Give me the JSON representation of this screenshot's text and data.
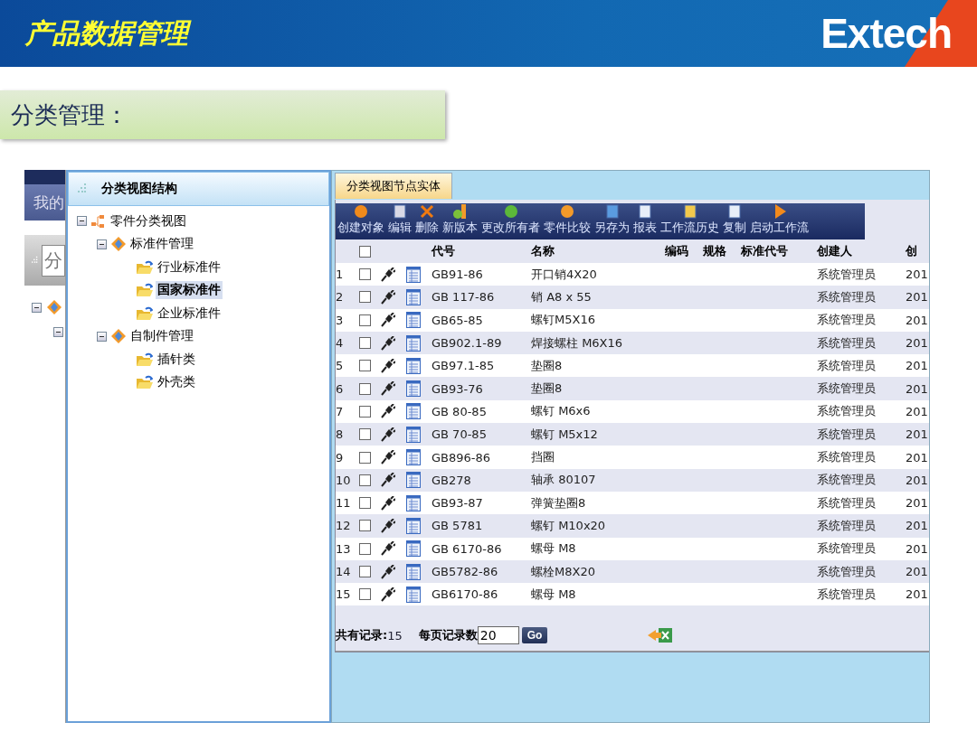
{
  "header": {
    "title": "产品数据管理",
    "logo": "Extech"
  },
  "section": {
    "label": "分类管理："
  },
  "back_window": {
    "tab": "我的",
    "field": "分"
  },
  "tree_panel": {
    "title": "分类视图结构",
    "nodes": [
      {
        "label": "零件分类视图",
        "kind": "root",
        "expanded": true,
        "selected": false,
        "children": [
          {
            "label": "标准件管理",
            "kind": "group",
            "expanded": true,
            "selected": false,
            "children": [
              {
                "label": "行业标准件",
                "kind": "folder",
                "selected": false
              },
              {
                "label": "国家标准件",
                "kind": "folder",
                "selected": true
              },
              {
                "label": "企业标准件",
                "kind": "folder",
                "selected": false
              }
            ]
          },
          {
            "label": "自制件管理",
            "kind": "group",
            "expanded": true,
            "selected": false,
            "children": [
              {
                "label": "插针类",
                "kind": "folder",
                "selected": false
              },
              {
                "label": "外壳类",
                "kind": "folder",
                "selected": false
              }
            ]
          }
        ]
      }
    ]
  },
  "tabs": [
    {
      "label": "分类视图节点实体",
      "selected": true
    }
  ],
  "toolbar": [
    {
      "label": "创建对象",
      "kind": "create"
    },
    {
      "label": "编辑",
      "kind": "edit"
    },
    {
      "label": "删除",
      "kind": "delete"
    },
    {
      "label": "新版本",
      "kind": "version"
    },
    {
      "label": "更改所有者",
      "kind": "owner"
    },
    {
      "label": "零件比较",
      "kind": "compare"
    },
    {
      "label": "另存为",
      "kind": "saveas"
    },
    {
      "label": "报表",
      "kind": "report"
    },
    {
      "label": "工作流历史",
      "kind": "history"
    },
    {
      "label": "复制",
      "kind": "copy"
    },
    {
      "label": "启动工作流",
      "kind": "start"
    }
  ],
  "table": {
    "select_all_checked": false,
    "columns": [
      "代号",
      "名称",
      "编码",
      "规格",
      "标准代号",
      "创建人",
      "创"
    ],
    "rows": [
      {
        "index": "1",
        "checked": false,
        "code": "GB91-86",
        "name": "开口销4X20",
        "creator": "系统管理员",
        "column_7": "201"
      },
      {
        "index": "2",
        "checked": false,
        "code": "GB 117-86",
        "name": "销  A8 x 55",
        "creator": "系统管理员",
        "column_7": "201"
      },
      {
        "index": "3",
        "checked": false,
        "code": "GB65-85",
        "name": "螺钉M5X16",
        "creator": "系统管理员",
        "column_7": "201"
      },
      {
        "index": "4",
        "checked": false,
        "code": "GB902.1-89",
        "name": "焊接螺柱  M6X16",
        "creator": "系统管理员",
        "column_7": "201"
      },
      {
        "index": "5",
        "checked": false,
        "code": "GB97.1-85",
        "name": "垫圈8",
        "creator": "系统管理员",
        "column_7": "201"
      },
      {
        "index": "6",
        "checked": false,
        "code": "GB93-76",
        "name": "垫圈8",
        "creator": "系统管理员",
        "column_7": "201"
      },
      {
        "index": "7",
        "checked": false,
        "code": "GB 80-85",
        "name": "螺钉  M6x6",
        "creator": "系统管理员",
        "column_7": "201"
      },
      {
        "index": "8",
        "checked": false,
        "code": "GB 70-85",
        "name": "螺钉  M5x12",
        "creator": "系统管理员",
        "column_7": "201"
      },
      {
        "index": "9",
        "checked": false,
        "code": "GB896-86",
        "name": "挡圈",
        "creator": "系统管理员",
        "column_7": "201"
      },
      {
        "index": "10",
        "checked": false,
        "code": "GB278",
        "name": "轴承  80107",
        "creator": "系统管理员",
        "column_7": "201"
      },
      {
        "index": "11",
        "checked": false,
        "code": "GB93-87",
        "name": "弹簧垫圈8",
        "creator": "系统管理员",
        "column_7": "201"
      },
      {
        "index": "12",
        "checked": false,
        "code": "GB 5781",
        "name": "螺钉  M10x20",
        "creator": "系统管理员",
        "column_7": "201"
      },
      {
        "index": "13",
        "checked": false,
        "code": "GB 6170-86",
        "name": "螺母  M8",
        "creator": "系统管理员",
        "column_7": "201"
      },
      {
        "index": "14",
        "checked": false,
        "code": "GB5782-86",
        "name": "螺栓M8X20",
        "creator": "系统管理员",
        "column_7": "201"
      },
      {
        "index": "15",
        "checked": false,
        "code": "GB6170-86",
        "name": "螺母  M8",
        "creator": "系统管理员",
        "column_7": "201"
      }
    ]
  },
  "footer": {
    "total_label": "共有记录:",
    "total": "15",
    "page_size_label": "每页记录数",
    "page_size": "20",
    "go_button": "Go"
  }
}
